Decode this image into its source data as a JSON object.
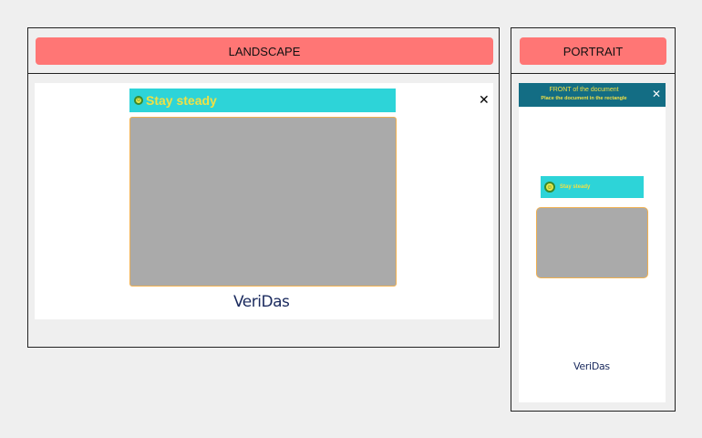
{
  "landscape": {
    "button_label": "LANDSCAPE",
    "stay_steady": "Stay steady",
    "close_symbol": "✕",
    "logo": "VeriDas"
  },
  "portrait": {
    "button_label": "PORTRAIT",
    "doc_title": "FRONT of the document",
    "doc_instruction": "Place the document in the rectangle",
    "close_symbol": "✕",
    "stay_steady": "Stay steady",
    "logo": "VeriDas"
  },
  "icons": {
    "close": "close-icon",
    "steady": "steady-face-icon"
  },
  "colors": {
    "button_bg": "#ff7675",
    "steady_bar": "#2dd4d8",
    "steady_text": "#f0e045",
    "doc_header": "#136d84",
    "camera_frame": "#aaaaaa",
    "camera_border": "#f0b050",
    "logo": "#1a2a5e"
  }
}
